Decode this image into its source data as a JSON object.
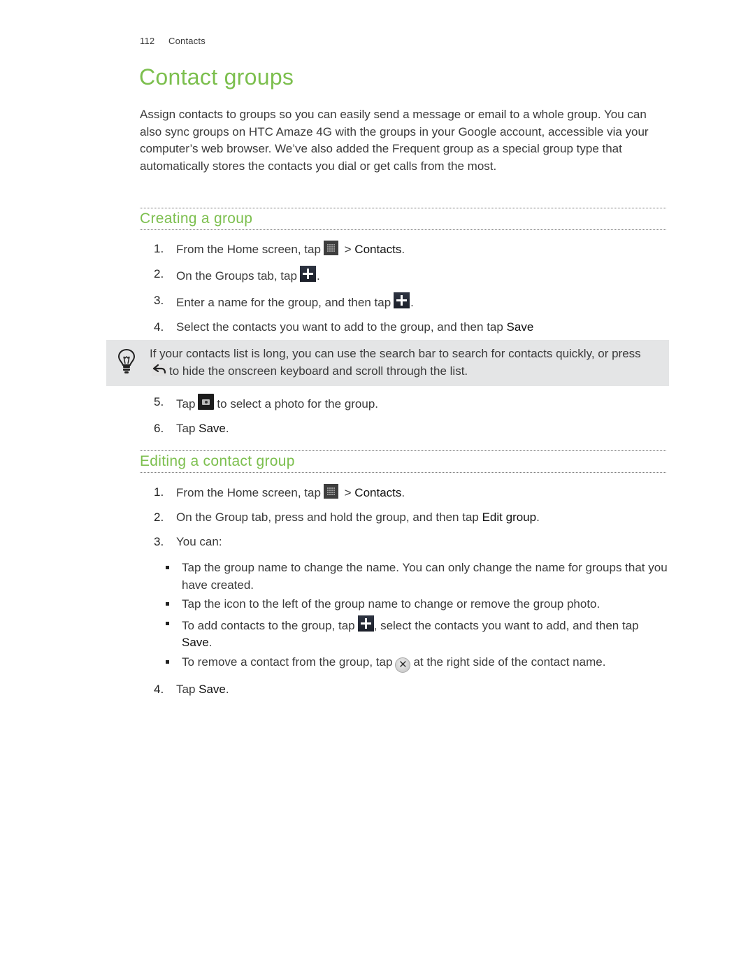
{
  "header": {
    "page_number": "112",
    "chapter": "Contacts"
  },
  "title": "Contact groups",
  "intro": "Assign contacts to groups so you can easily send a message or email to a whole group. You can also sync groups on HTC Amaze 4G with the groups in your Google account, accessible via your computer’s web browser. We’ve also added the Frequent group as a special group type that automatically stores the contacts you dial or get calls from the most.",
  "colors": {
    "accent_green": "#7cbf4e",
    "body_text": "#3a3a3a",
    "tip_background": "#e4e5e6"
  },
  "creating": {
    "heading": "Creating a group",
    "steps": [
      {
        "num": "1.",
        "pre": "From the Home screen, tap",
        "icon": "all-apps-icon",
        "mid": " > ",
        "em": "Contacts",
        "post": "."
      },
      {
        "num": "2.",
        "pre": "On the Groups tab, tap",
        "icon": "add-icon",
        "post": "."
      },
      {
        "num": "3.",
        "pre": "Enter a name for the group, and then tap",
        "icon": "add-icon",
        "post": "."
      },
      {
        "num": "4.",
        "pre": "Select the contacts you want to add to the group, and then tap ",
        "em": "Save"
      }
    ],
    "tip": {
      "icon": "lightbulb-icon",
      "pre": "If your contacts list is long, you can use the search bar to search for contacts quickly, or press",
      "key_icon": "back-arrow-icon",
      "post": "to hide the onscreen keyboard and scroll through the list."
    },
    "steps_after": [
      {
        "num": "5.",
        "pre": "Tap",
        "icon": "camera-icon",
        "post": "to select a photo for the group."
      },
      {
        "num": "6.",
        "pre": "Tap ",
        "em": "Save",
        "post": "."
      }
    ]
  },
  "editing": {
    "heading": "Editing a contact group",
    "steps": [
      {
        "num": "1.",
        "pre": "From the Home screen, tap",
        "icon": "all-apps-icon",
        "mid": " > ",
        "em": "Contacts",
        "post": "."
      },
      {
        "num": "2.",
        "pre": "On the Group tab, press and hold the group, and then tap ",
        "em": "Edit group",
        "post": "."
      },
      {
        "num": "3.",
        "pre": "You can:"
      },
      {
        "num": "4.",
        "pre": "Tap ",
        "em": "Save",
        "post": "."
      }
    ],
    "bullets": [
      {
        "text": "Tap the group name to change the name. You can only change the name for groups that you have created."
      },
      {
        "text": "Tap the icon to the left of the group name to change or remove the group photo."
      },
      {
        "pre": "To add contacts to the group, tap",
        "icon": "add-icon",
        "post": ", select the contacts you want to add, and then tap ",
        "em": "Save",
        "post2": "."
      },
      {
        "pre": "To remove a contact from the group, tap",
        "icon": "remove-icon",
        "post": "at the right side of the contact name."
      }
    ]
  }
}
